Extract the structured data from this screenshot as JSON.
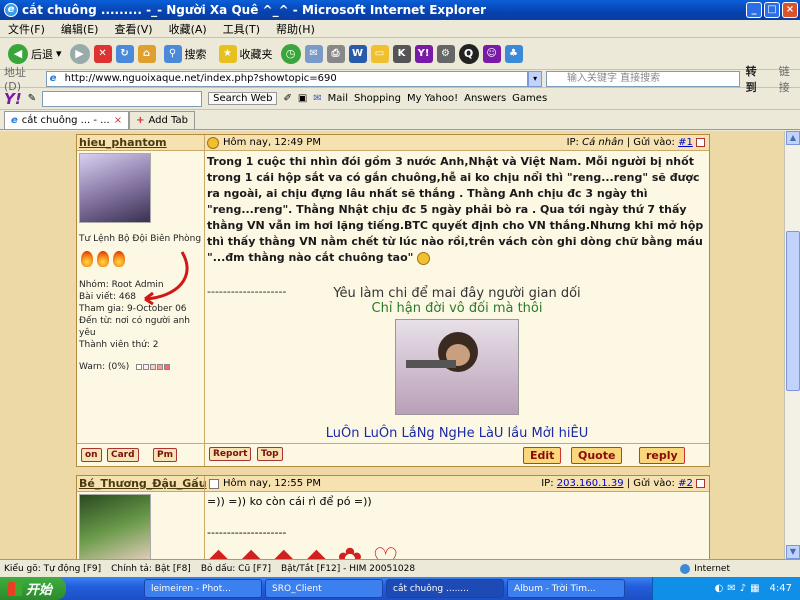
{
  "window": {
    "title": "cắt chuông ......... -_- Người Xa Quê ^_^ - Microsoft Internet Explorer",
    "min": "_",
    "max": "□",
    "close": "×"
  },
  "menu": [
    "文件(F)",
    "编辑(E)",
    "查看(V)",
    "收藏(A)",
    "工具(T)",
    "帮助(H)"
  ],
  "toolbar": {
    "back": "后退",
    "search": "搜索",
    "favorites": "收藏夹"
  },
  "address": {
    "label": "地址(D)",
    "url": "http://www.nguoixaque.net/index.php?showtopic=690",
    "search_hint": "输入关键字 直接搜索",
    "go": "转到",
    "links": "链接"
  },
  "yahoo": {
    "logo": "Y!",
    "search_web": "Search Web",
    "mail": "Mail",
    "shopping": "Shopping",
    "myyahoo": "My Yahoo!",
    "answers": "Answers",
    "games": "Games"
  },
  "tabs": [
    {
      "label": "cắt chuông ... - ..."
    },
    {
      "label": "Add Tab"
    }
  ],
  "posts": [
    {
      "user": "hieu_phantom",
      "time": "Hôm nay, 12:49 PM",
      "ip_label": "IP:",
      "ip": "Cá nhân",
      "sent_label": "Gửi vào:",
      "num": "#1",
      "rank": "Tư Lệnh Bộ Đội Biên Phòng",
      "info": [
        "Nhóm: Root Admin",
        "Bài viết: 468",
        "Tham gia: 9-October 06",
        "Đến từ: nơi có người anh yêu",
        "Thành viên thứ: 2"
      ],
      "warn": "Warn: (0%)",
      "body": "Trong 1 cuộc thi nhìn đói gồm 3 nước Anh,Nhật và Việt Nam. Mỗi người bị nhốt trong 1 cái hộp sắt va có gắn chuông,hễ ai ko chịu nổi thì \"reng...reng\" sẽ được ra ngoài, ai chịu đựng lâu nhất sẽ thắng . Thằng Anh chịu đc 3 ngày thì \"reng...reng\". Thằng Nhật chịu đc 5 ngày phải bò ra . Qua tới ngày thứ 7 thấy thằng VN vẫn im hơi lặng tiếng.BTC quyết định cho VN thắng.Nhưng khi mở hộp thì thấy thằng VN nằm chết từ lúc nào rồi,trên vách còn ghi dòng chữ bằng máu \"...đm thằng nào cắt chuông tao\"",
      "divider": "--------------------",
      "sig1": "Yêu làm chi để mai đây người gian dối",
      "sig2": "Chỉ hận đời vô đối mà thôi",
      "sig3": "LuÔn LuÔn LắNg NgHe LàU lầu MởI hiÊU",
      "btns_left": [
        "on",
        "Card",
        "Pm"
      ],
      "btns_mid": [
        "Report",
        "Top"
      ],
      "btns_right": [
        "Edit",
        "Quote",
        "reply"
      ]
    },
    {
      "user": "Bé_Thương_Đậu_Gấu",
      "time": "Hôm nay, 12:55 PM",
      "ip_label": "IP:",
      "ip": "203.160.1.39",
      "sent_label": "Gửi vào:",
      "num": "#2",
      "body": "=)) =)) ko còn cái rì để pó =))",
      "divider": "--------------------"
    }
  ],
  "statusbar": [
    "Kiểu gõ: Tự động [F9]",
    "Chính tả: Bật [F8]",
    "Bỏ dấu: Cũ [F7]",
    "Bật/Tắt [F12] - HIM 20051028",
    "Internet"
  ],
  "taskbar": {
    "start": "开始",
    "tasks": [
      "leimeiren - Phot...",
      "SRO_Client",
      "cắt chuông ........",
      "Album - Trời Tim..."
    ],
    "clock": "4:47"
  }
}
